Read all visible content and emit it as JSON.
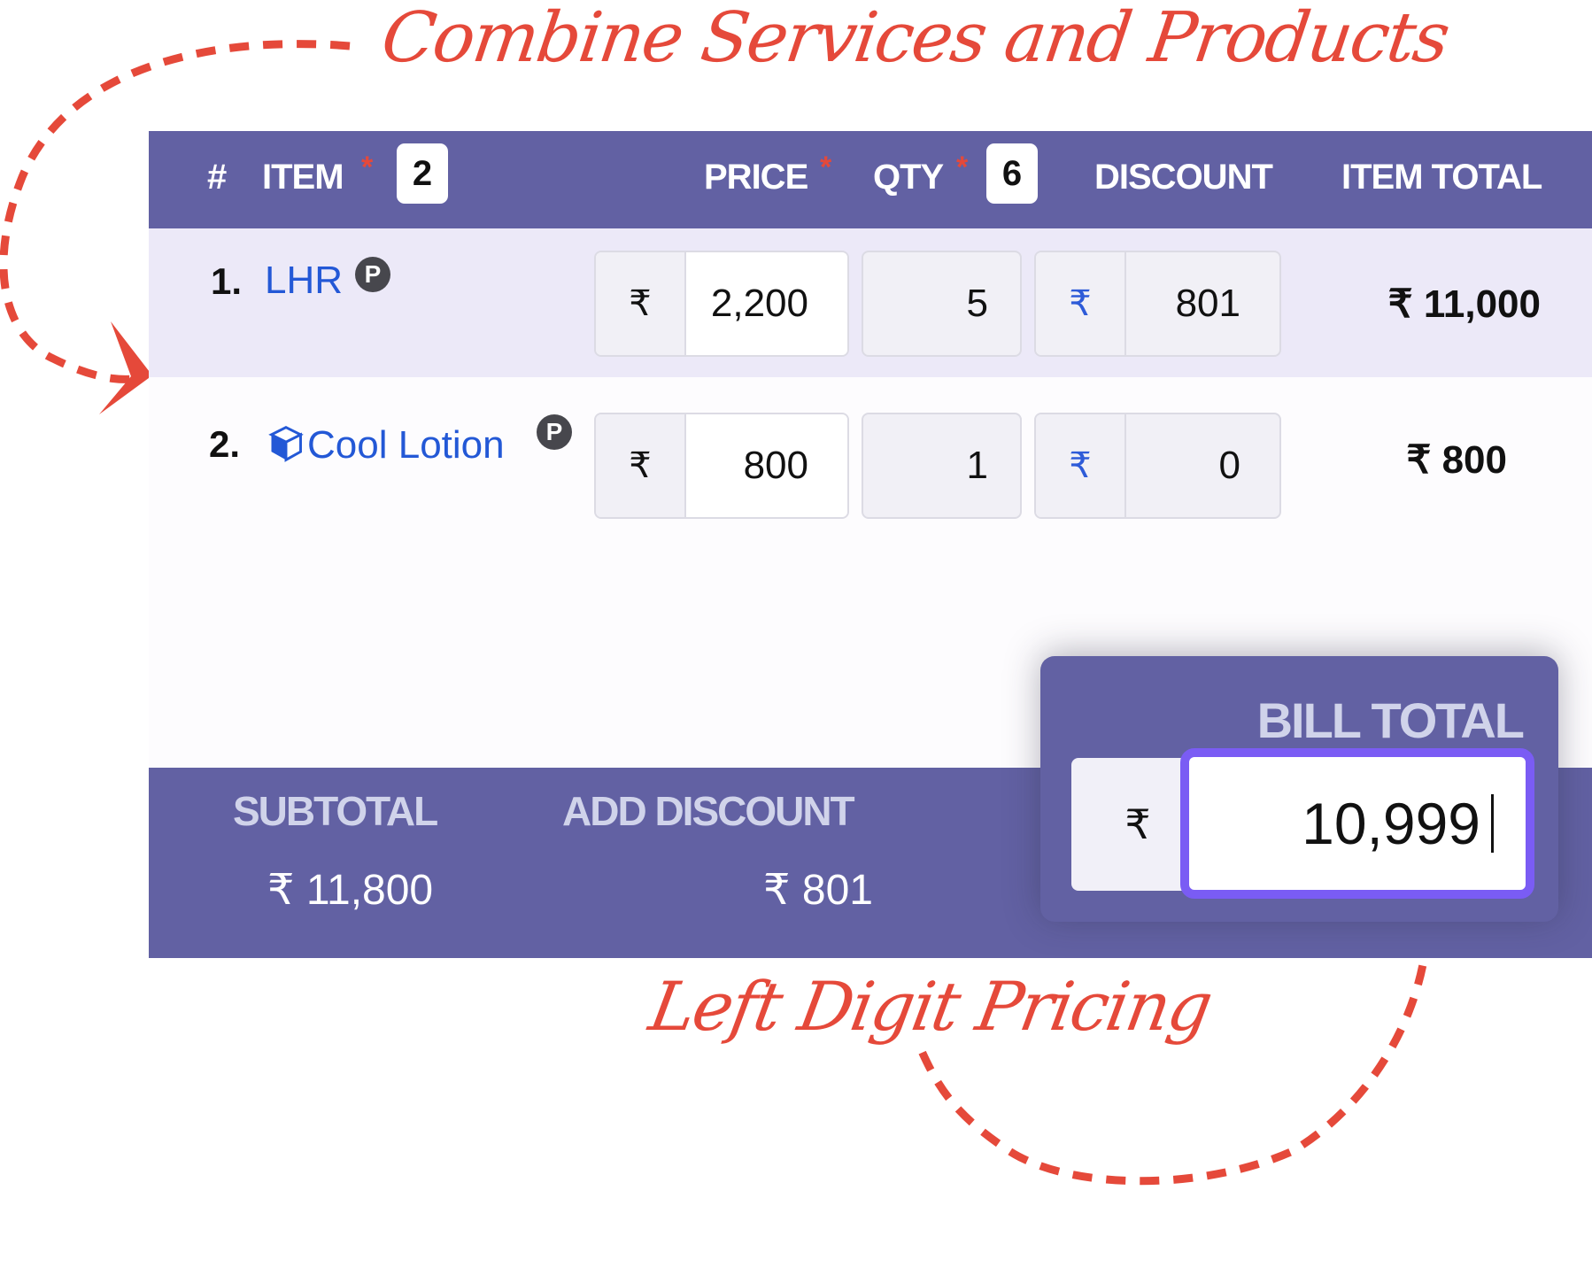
{
  "annotations": {
    "top": "Combine Services and Products",
    "bottom": "Left Digit Pricing",
    "color": "#e5493a"
  },
  "header": {
    "hash": "#",
    "item": "ITEM",
    "item_count": "2",
    "price": "PRICE",
    "qty": "QTY",
    "qty_count": "6",
    "discount": "DISCOUNT",
    "item_total": "ITEM TOTAL",
    "required_marker": "*"
  },
  "currency_symbol": "₹",
  "items": [
    {
      "index": "1.",
      "name": "LHR",
      "type": "service",
      "badge": "P",
      "price": "2,200",
      "qty": "5",
      "discount": "801",
      "item_total": "₹ 11,000"
    },
    {
      "index": "2.",
      "name": "Cool Lotion",
      "type": "product",
      "icon": "cube-icon",
      "badge": "P",
      "price": "800",
      "qty": "1",
      "discount": "0",
      "item_total": "₹ 800"
    }
  ],
  "footer": {
    "subtotal_label": "SUBTOTAL",
    "subtotal_value": "₹ 11,800",
    "add_discount_label": "ADD DISCOUNT",
    "add_discount_value": "₹ 801"
  },
  "bill_total": {
    "label": "BILL TOTAL",
    "currency": "₹",
    "value": "10,999"
  },
  "colors": {
    "brand": "#6261a3",
    "row_highlight": "#ece9f8",
    "link": "#2358d6",
    "focus_ring": "#7a5cf4",
    "accent": "#e5493a"
  }
}
